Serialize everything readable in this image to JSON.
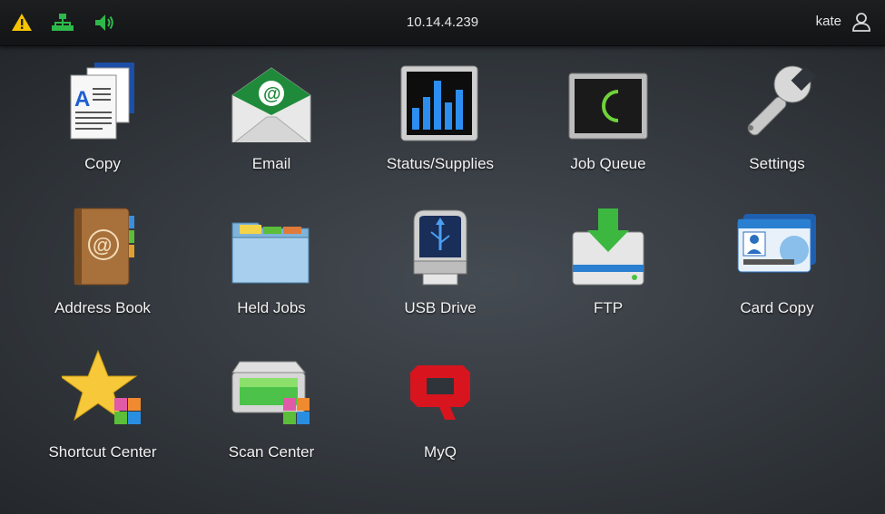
{
  "status_bar": {
    "ip_address": "10.14.4.239",
    "username": "kate",
    "icons": [
      "warning-icon",
      "network-icon",
      "speaker-icon",
      "user-icon"
    ]
  },
  "apps": [
    {
      "label": "Copy",
      "icon": "copy-icon"
    },
    {
      "label": "Email",
      "icon": "email-icon"
    },
    {
      "label": "Status/Supplies",
      "icon": "status-supplies-icon"
    },
    {
      "label": "Job Queue",
      "icon": "job-queue-icon"
    },
    {
      "label": "Settings",
      "icon": "settings-icon"
    },
    {
      "label": "Address Book",
      "icon": "address-book-icon"
    },
    {
      "label": "Held Jobs",
      "icon": "held-jobs-icon"
    },
    {
      "label": "USB Drive",
      "icon": "usb-drive-icon"
    },
    {
      "label": "FTP",
      "icon": "ftp-icon"
    },
    {
      "label": "Card Copy",
      "icon": "card-copy-icon"
    },
    {
      "label": "Shortcut Center",
      "icon": "shortcut-center-icon"
    },
    {
      "label": "Scan Center",
      "icon": "scan-center-icon"
    },
    {
      "label": "MyQ",
      "icon": "myq-icon"
    }
  ],
  "colors": {
    "warning": "#f5c400",
    "network": "#2fb84a",
    "speaker": "#2fb84a",
    "myq_brand": "#d8141e"
  }
}
